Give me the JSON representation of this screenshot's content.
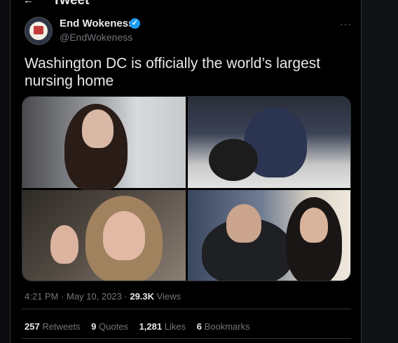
{
  "header": {
    "back_icon": "arrow-left-icon",
    "title": "Tweet"
  },
  "author": {
    "name": "End Wokeness",
    "handle": "@EndWokeness",
    "verified_icon": "verified-badge-icon",
    "verified_color": "#1d9bf0"
  },
  "more_label": "···",
  "tweet": {
    "text": "Washington DC is officially the world’s largest nursing home"
  },
  "media": {
    "count": 4,
    "photos": [
      "photo-1",
      "photo-2",
      "photo-3",
      "photo-4"
    ]
  },
  "meta": {
    "time": "4:21 PM",
    "separator": " · ",
    "date": "May 10, 2023",
    "views_count": "29.3K",
    "views_label": "Views"
  },
  "stats": {
    "retweets_count": "257",
    "retweets_label": "Retweets",
    "quotes_count": "9",
    "quotes_label": "Quotes",
    "likes_count": "1,281",
    "likes_label": "Likes",
    "bookmarks_count": "6",
    "bookmarks_label": "Bookmarks"
  }
}
